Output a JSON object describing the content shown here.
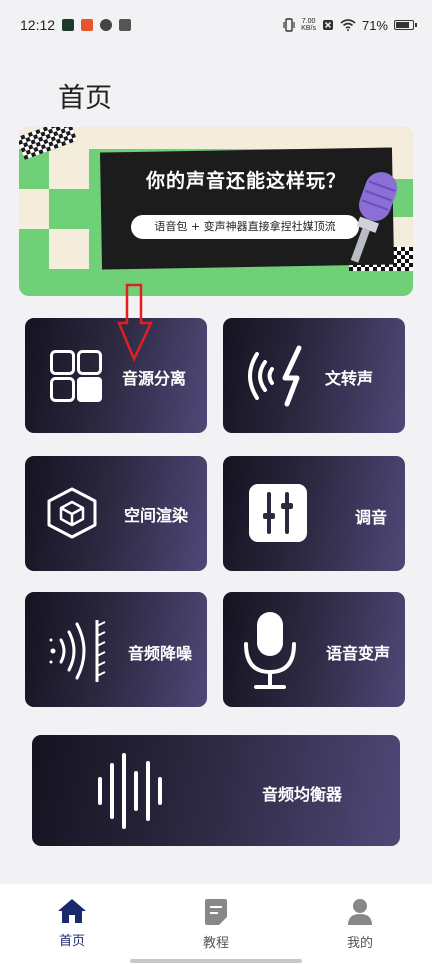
{
  "status_bar": {
    "time": "12:12",
    "app_icons": [
      "n-app-icon",
      "red-app-icon",
      "link-app-icon",
      "mail-app-icon"
    ],
    "net_speed_value": "7.00",
    "net_speed_unit": "KB/s",
    "battery": "71%",
    "battery_level": 0.71
  },
  "header": {
    "title": "首页"
  },
  "banner": {
    "title": "你的声音还能这样玩？",
    "subtitle": "语音包 + 变声神器直接拿捏社媒顶流",
    "colors": {
      "green": "#70d078",
      "cream": "#f4eddc",
      "dark": "#1c1c1c",
      "mic": "#8b6fd6"
    }
  },
  "features": [
    {
      "label": "音源分离",
      "icon": "grid-icon"
    },
    {
      "label": "文转声",
      "icon": "sound-wave-icon"
    },
    {
      "label": "空间渲染",
      "icon": "cube-icon"
    },
    {
      "label": "调音",
      "icon": "sliders-icon"
    },
    {
      "label": "音频降噪",
      "icon": "noise-reduction-icon"
    },
    {
      "label": "语音变声",
      "icon": "microphone-icon"
    },
    {
      "label": "音频均衡器",
      "icon": "equalizer-bars-icon"
    }
  ],
  "annotation": {
    "icon": "red-arrow-down-icon",
    "color": "#e02020"
  },
  "bottom_nav": [
    {
      "label": "首页",
      "icon": "home-icon",
      "active": true
    },
    {
      "label": "教程",
      "icon": "document-icon",
      "active": false
    },
    {
      "label": "我的",
      "icon": "person-icon",
      "active": false
    }
  ],
  "theme": {
    "tile_gradient_start": "#141320",
    "tile_gradient_end": "#4f4878",
    "nav_active": "#1a2a6c"
  }
}
